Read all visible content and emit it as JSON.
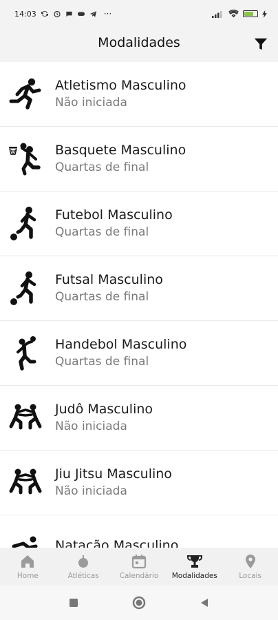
{
  "status_bar": {
    "time": "14:03",
    "icons_left": [
      "sync-icon",
      "alarm-icon",
      "chat-icon",
      "gamepad-icon",
      "telegram-icon"
    ],
    "more_label": "···",
    "battery_label": "64",
    "icons_right": [
      "signal-icon",
      "wifi-icon",
      "battery-icon",
      "charging-icon"
    ]
  },
  "header": {
    "title": "Modalidades",
    "filter_icon": "filter-icon"
  },
  "list": {
    "items": [
      {
        "title": "Atletismo Masculino",
        "status": "Não iniciada",
        "icon": "running-icon"
      },
      {
        "title": "Basquete Masculino",
        "status": "Quartas de final",
        "icon": "basketball-icon"
      },
      {
        "title": "Futebol Masculino",
        "status": "Quartas de final",
        "icon": "soccer-icon"
      },
      {
        "title": "Futsal Masculino",
        "status": "Quartas de final",
        "icon": "futsal-icon"
      },
      {
        "title": "Handebol Masculino",
        "status": "Quartas de final",
        "icon": "handball-icon"
      },
      {
        "title": "Judô Masculino",
        "status": "Não iniciada",
        "icon": "judo-icon"
      },
      {
        "title": "Jiu Jitsu Masculino",
        "status": "Não iniciada",
        "icon": "jiujitsu-icon"
      },
      {
        "title": "Natação Masculino",
        "status": "",
        "icon": "swimming-icon"
      }
    ]
  },
  "bottom_nav": {
    "items": [
      {
        "label": "Home",
        "icon": "home-icon",
        "active": false
      },
      {
        "label": "Atléticas",
        "icon": "atleticas-icon",
        "active": false
      },
      {
        "label": "Calendário",
        "icon": "calendar-icon",
        "active": false
      },
      {
        "label": "Modalidades",
        "icon": "trophy-icon",
        "active": true
      },
      {
        "label": "Locais",
        "icon": "location-icon",
        "active": false
      }
    ]
  },
  "system_nav": {
    "items": [
      "recent-apps-icon",
      "home-circle-icon",
      "back-icon"
    ]
  },
  "colors": {
    "background": "#ffffff",
    "bar": "#f3f3f3",
    "title": "#1b1b1b",
    "subtitle": "#7a7a7a",
    "nav_active": "#222222",
    "nav_inactive": "#9b9b9b",
    "battery": "#8bc34a"
  }
}
